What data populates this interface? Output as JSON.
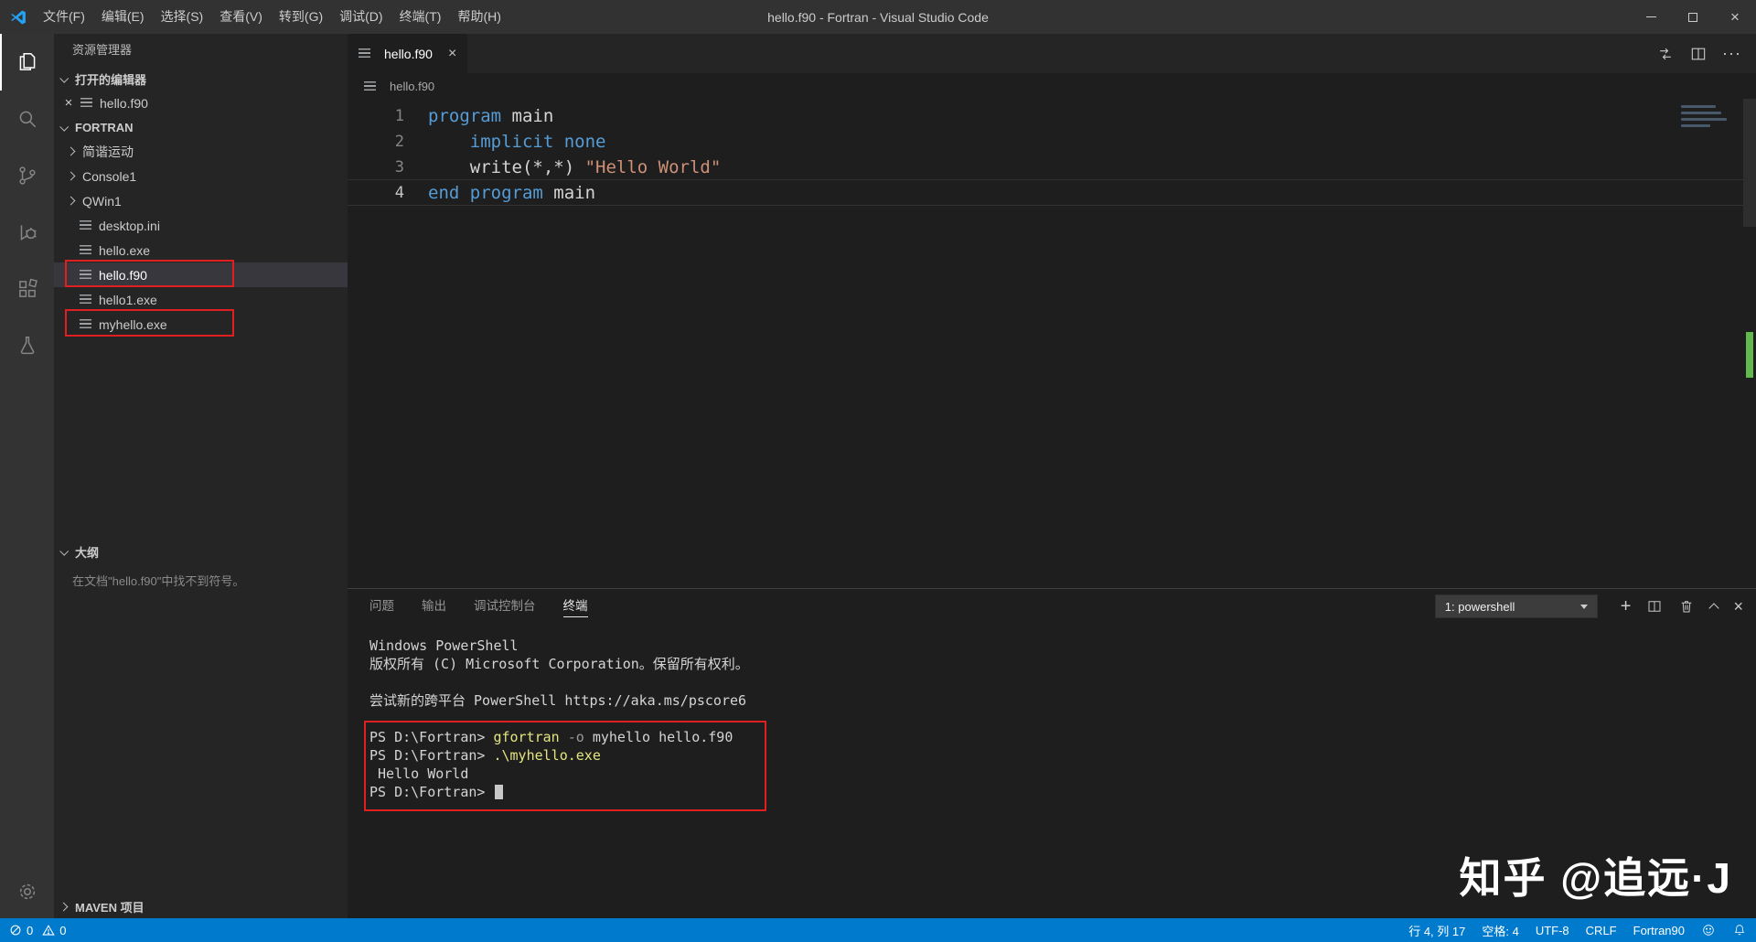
{
  "titlebar": {
    "menus": [
      "文件(F)",
      "编辑(E)",
      "选择(S)",
      "查看(V)",
      "转到(G)",
      "调试(D)",
      "终端(T)",
      "帮助(H)"
    ],
    "title": "hello.f90 - Fortran - Visual Studio Code"
  },
  "activity_bar": {
    "icons": [
      "explorer-icon",
      "search-icon",
      "source-control-icon",
      "run-debug-icon",
      "extensions-icon",
      "test-flask-icon",
      "settings-gear-icon"
    ]
  },
  "sidebar": {
    "title": "资源管理器",
    "open_editors": {
      "label": "打开的编辑器",
      "items": [
        {
          "label": "hello.f90"
        }
      ]
    },
    "fortran": {
      "label": "FORTRAN",
      "items": [
        {
          "label": "简谐运动",
          "type": "folder"
        },
        {
          "label": "Console1",
          "type": "folder"
        },
        {
          "label": "QWin1",
          "type": "folder"
        },
        {
          "label": "desktop.ini",
          "type": "file"
        },
        {
          "label": "hello.exe",
          "type": "file"
        },
        {
          "label": "hello.f90",
          "type": "file",
          "selected": true,
          "annotated": true
        },
        {
          "label": "hello1.exe",
          "type": "file"
        },
        {
          "label": "myhello.exe",
          "type": "file",
          "annotated": true
        }
      ]
    },
    "outline": {
      "label": "大纲",
      "empty_text": "在文档\"hello.f90\"中找不到符号。"
    },
    "maven": {
      "label": "MAVEN 项目"
    }
  },
  "editor": {
    "tab_label": "hello.f90",
    "breadcrumb": "hello.f90",
    "code_lines": [
      {
        "num": "1",
        "tokens": [
          {
            "t": "program",
            "c": "kw"
          },
          {
            "t": " main",
            "c": "pl"
          }
        ]
      },
      {
        "num": "2",
        "tokens": [
          {
            "t": "    ",
            "c": "pl"
          },
          {
            "t": "implicit none",
            "c": "kw"
          }
        ]
      },
      {
        "num": "3",
        "tokens": [
          {
            "t": "    write(*,*) ",
            "c": "pl"
          },
          {
            "t": "\"Hello World\"",
            "c": "str"
          }
        ]
      },
      {
        "num": "4",
        "current": true,
        "tokens": [
          {
            "t": "end program",
            "c": "kw"
          },
          {
            "t": " main",
            "c": "pl"
          }
        ]
      }
    ]
  },
  "panel": {
    "tabs": [
      {
        "label": "问题"
      },
      {
        "label": "输出"
      },
      {
        "label": "调试控制台"
      },
      {
        "label": "终端",
        "active": true
      }
    ],
    "terminal_dropdown": "1: powershell",
    "terminal_lines": [
      {
        "tokens": [
          {
            "t": "Windows PowerShell",
            "c": "pl"
          }
        ]
      },
      {
        "tokens": [
          {
            "t": "版权所有 (C) Microsoft Corporation。保留所有权利。",
            "c": "pl"
          }
        ]
      },
      {
        "tokens": []
      },
      {
        "tokens": [
          {
            "t": "尝试新的跨平台 PowerShell https://aka.ms/pscore6",
            "c": "pl"
          }
        ]
      },
      {
        "tokens": []
      },
      {
        "tokens": [
          {
            "t": "PS D:\\Fortran> ",
            "c": "pl"
          },
          {
            "t": "gfortran",
            "c": "cmd"
          },
          {
            "t": " ",
            "c": "pl"
          },
          {
            "t": "-o",
            "c": "param"
          },
          {
            "t": " myhello hello.f90",
            "c": "pl"
          }
        ]
      },
      {
        "tokens": [
          {
            "t": "PS D:\\Fortran> ",
            "c": "pl"
          },
          {
            "t": ".\\myhello.exe",
            "c": "cmd"
          }
        ]
      },
      {
        "tokens": [
          {
            "t": " Hello World",
            "c": "pl"
          }
        ]
      },
      {
        "cursor": true,
        "tokens": [
          {
            "t": "PS D:\\Fortran> ",
            "c": "pl"
          }
        ]
      }
    ]
  },
  "statusbar": {
    "errors": "0",
    "warnings": "0",
    "cursor_position": "行 4, 列 17",
    "indent": "空格: 4",
    "encoding": "UTF-8",
    "eol": "CRLF",
    "language": "Fortran90"
  },
  "watermark": "知乎 @追远·J",
  "colors": {
    "accent": "#007acc",
    "keyword": "#569cd6",
    "string": "#ce9178",
    "terminal_command": "#e5e580",
    "annotation_red": "#e02020",
    "selection_bg": "#37373d"
  }
}
